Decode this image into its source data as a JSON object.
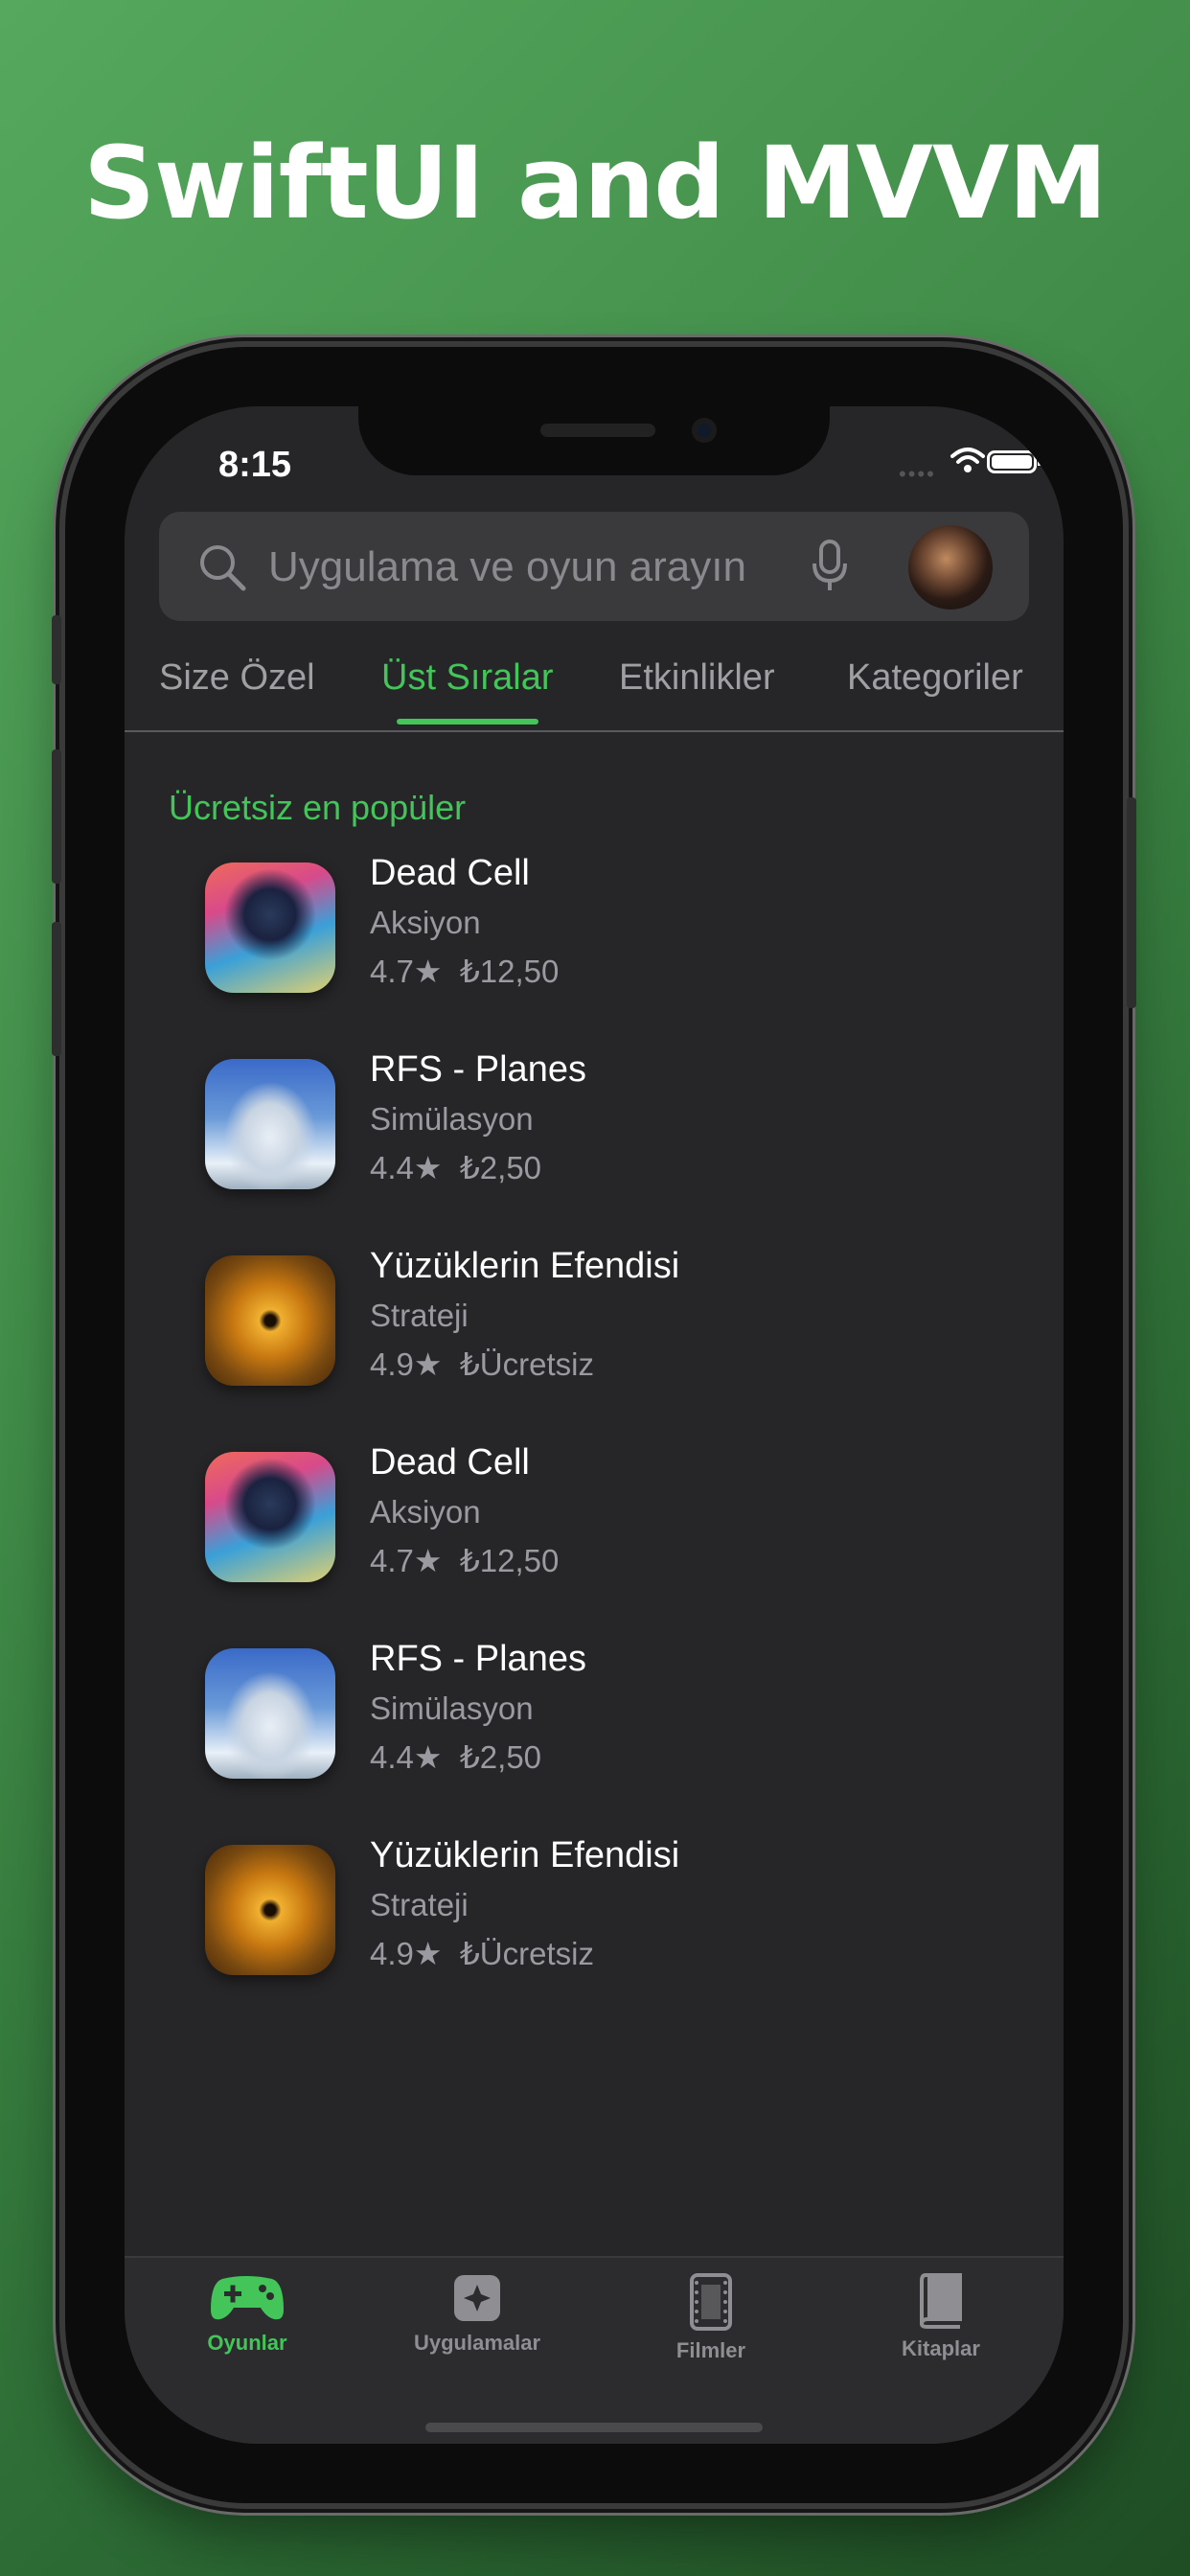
{
  "headline": "SwiftUI and MVVM",
  "status_bar": {
    "time": "8:15",
    "signal_icon": "signal-dots-icon",
    "wifi_icon": "wifi-icon",
    "battery_icon": "battery-icon"
  },
  "search": {
    "placeholder": "Uygulama ve oyun arayın",
    "icon": "magnifying-glass-icon",
    "mic_icon": "mic-icon"
  },
  "tabs": [
    {
      "label": "Size Özel",
      "active": false
    },
    {
      "label": "Üst Sıralar",
      "active": true
    },
    {
      "label": "Etkinlikler",
      "active": false
    },
    {
      "label": "Kategoriler",
      "active": false
    }
  ],
  "section": {
    "title": "Ücretsiz en popüler"
  },
  "apps": [
    {
      "name": "Dead Cell",
      "category": "Aksiyon",
      "rating": "4.7★",
      "price": "₺12,50"
    },
    {
      "name": "RFS - Planes",
      "category": "Simülasyon",
      "rating": "4.4★",
      "price": "₺2,50"
    },
    {
      "name": "Yüzüklerin Efendisi",
      "category": "Strateji",
      "rating": "4.9★",
      "price": "₺Ücretsiz"
    },
    {
      "name": "Dead Cell",
      "category": "Aksiyon",
      "rating": "4.7★",
      "price": "₺12,50"
    },
    {
      "name": "RFS - Planes",
      "category": "Simülasyon",
      "rating": "4.4★",
      "price": "₺2,50"
    },
    {
      "name": "Yüzüklerin Efendisi",
      "category": "Strateji",
      "rating": "4.9★",
      "price": "₺Ücretsiz"
    }
  ],
  "tab_bar": [
    {
      "label": "Oyunlar",
      "icon": "gamecontroller-icon",
      "active": true
    },
    {
      "label": "Uygulamalar",
      "icon": "apps-icon",
      "active": false
    },
    {
      "label": "Filmler",
      "icon": "film-icon",
      "active": false
    },
    {
      "label": "Kitaplar",
      "icon": "book-icon",
      "active": false
    }
  ],
  "colors": {
    "accent": "#43c55a",
    "screen_bg": "#262628",
    "text_secondary": "#9a9aa0"
  }
}
